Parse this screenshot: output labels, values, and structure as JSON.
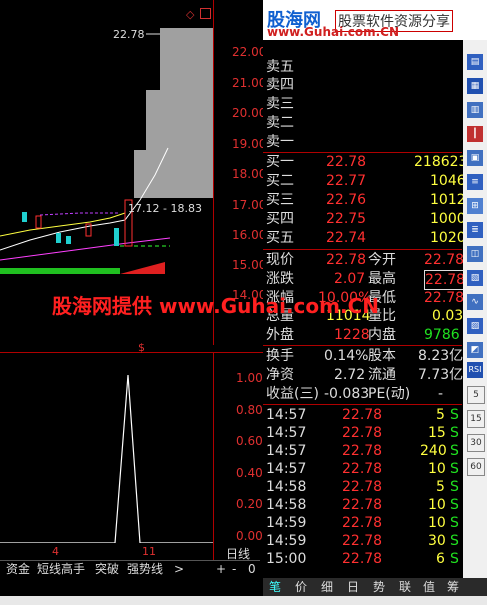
{
  "banner": {
    "logo": "股海网",
    "slogan": "股票软件资源分享",
    "url": "www.Guhai.com.CN"
  },
  "watermark": "股海网提供 www.Guhai.com.CN",
  "chart": {
    "price_axis": [
      "22.00",
      "21.00",
      "20.00",
      "19.00",
      "18.00",
      "17.00",
      "16.00",
      "15.00",
      "14.00"
    ],
    "high_label": "22.78",
    "range_label": "17.12 - 18.83",
    "indicator_axis": [
      "1.00",
      "0.80",
      "0.60",
      "0.40",
      "0.20",
      "0.00"
    ],
    "x_labels": [
      "4",
      "11"
    ],
    "indicator_marker": "$",
    "period": "日线"
  },
  "orderbook": {
    "sells": [
      {
        "label": "卖五"
      },
      {
        "label": "卖四"
      },
      {
        "label": "卖三"
      },
      {
        "label": "卖二"
      },
      {
        "label": "卖一"
      }
    ],
    "buys": [
      {
        "label": "买一",
        "price": "22.78",
        "vol": "218623"
      },
      {
        "label": "买二",
        "price": "22.77",
        "vol": "1046"
      },
      {
        "label": "买三",
        "price": "22.76",
        "vol": "1012"
      },
      {
        "label": "买四",
        "price": "22.75",
        "vol": "1000"
      },
      {
        "label": "买五",
        "price": "22.74",
        "vol": "1020"
      }
    ]
  },
  "quote": {
    "now_label": "现价",
    "now": "22.78",
    "open_label": "今开",
    "open": "22.78",
    "chg_label": "涨跌",
    "chg": "2.07",
    "high_label": "最高",
    "high": "22.78",
    "pct_label": "涨幅",
    "pct": "10.00%",
    "low_label": "最低",
    "low": "22.78",
    "vol_label": "总量",
    "vol": "11014",
    "vr_label": "量比",
    "vr": "0.03",
    "out_label": "外盘",
    "out": "1228",
    "in_label": "内盘",
    "in": "9786",
    "turn_label": "换手",
    "turn": "0.14%",
    "cap_label": "股本",
    "cap": "8.23亿",
    "na_label": "净资",
    "na": "2.72",
    "float_label": "流通",
    "float": "7.73亿",
    "eps_label": "收益(三)",
    "eps": "-0.083",
    "pe_label": "PE(动)",
    "pe": "-"
  },
  "ticks": [
    {
      "t": "14:57",
      "p": "22.78",
      "v": "5",
      "s": "S"
    },
    {
      "t": "14:57",
      "p": "22.78",
      "v": "15",
      "s": "S"
    },
    {
      "t": "14:57",
      "p": "22.78",
      "v": "240",
      "s": "S"
    },
    {
      "t": "14:57",
      "p": "22.78",
      "v": "10",
      "s": "S"
    },
    {
      "t": "14:58",
      "p": "22.78",
      "v": "5",
      "s": "S"
    },
    {
      "t": "14:58",
      "p": "22.78",
      "v": "10",
      "s": "S"
    },
    {
      "t": "14:59",
      "p": "22.78",
      "v": "10",
      "s": "S"
    },
    {
      "t": "14:59",
      "p": "22.78",
      "v": "30",
      "s": "S"
    },
    {
      "t": "15:00",
      "p": "22.78",
      "v": "6",
      "s": "S"
    }
  ],
  "toolbar": [
    "资金",
    "短线高手",
    "突破",
    "强势线",
    ">"
  ],
  "zoom": [
    "+",
    "-",
    "0"
  ],
  "bottom_tabs": [
    "笔",
    "价",
    "细",
    "日",
    "势",
    "联",
    "值",
    "筹"
  ],
  "side_icons": [
    "RSI",
    "5",
    "15",
    "30",
    "60"
  ]
}
